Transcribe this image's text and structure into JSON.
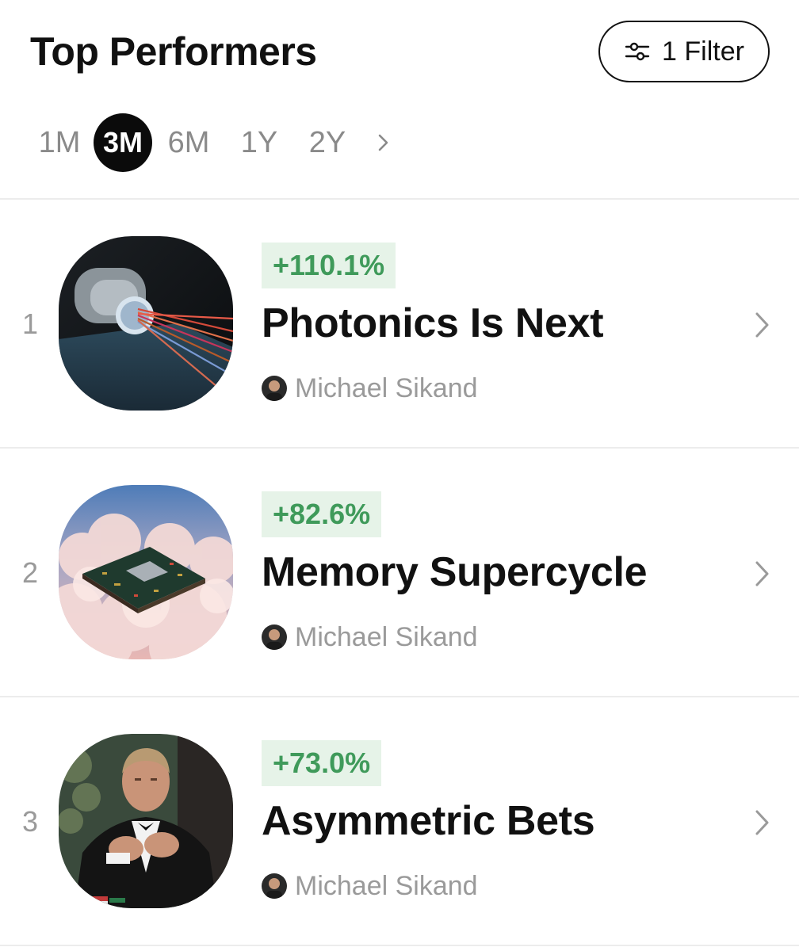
{
  "header": {
    "title": "Top Performers",
    "filter_label": "1 Filter",
    "filter_icon": "sliders-icon"
  },
  "ranges": {
    "items": [
      "1M",
      "3M",
      "6M",
      "1Y",
      "2Y"
    ],
    "selected": "3M",
    "more_icon": "chevron-right-icon"
  },
  "colors": {
    "accent_green": "#3f9a5a",
    "badge_bg": "#e6f3e8",
    "selected_bg": "#0b0b0b"
  },
  "performers": [
    {
      "rank": "1",
      "change": "+110.1%",
      "name": "Photonics Is Next",
      "author": "Michael Sikand",
      "image": "photonics-fiber-image"
    },
    {
      "rank": "2",
      "change": "+82.6%",
      "name": "Memory Supercycle",
      "author": "Michael Sikand",
      "image": "chip-in-clouds-image"
    },
    {
      "rank": "3",
      "change": "+73.0%",
      "name": "Asymmetric Bets",
      "author": "Michael Sikand",
      "image": "man-in-tuxedo-image"
    }
  ]
}
